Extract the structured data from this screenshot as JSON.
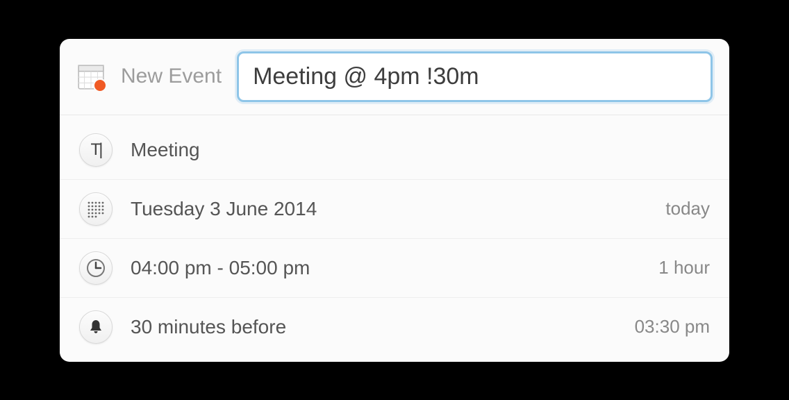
{
  "header": {
    "label": "New Event",
    "input_value": "Meeting @ 4pm !30m"
  },
  "rows": {
    "title": {
      "value": "Meeting"
    },
    "date": {
      "value": "Tuesday 3 June 2014",
      "relative": "today"
    },
    "time": {
      "value": "04:00 pm - 05:00 pm",
      "duration": "1 hour"
    },
    "alert": {
      "value": "30 minutes before",
      "at": "03:30 pm"
    }
  }
}
